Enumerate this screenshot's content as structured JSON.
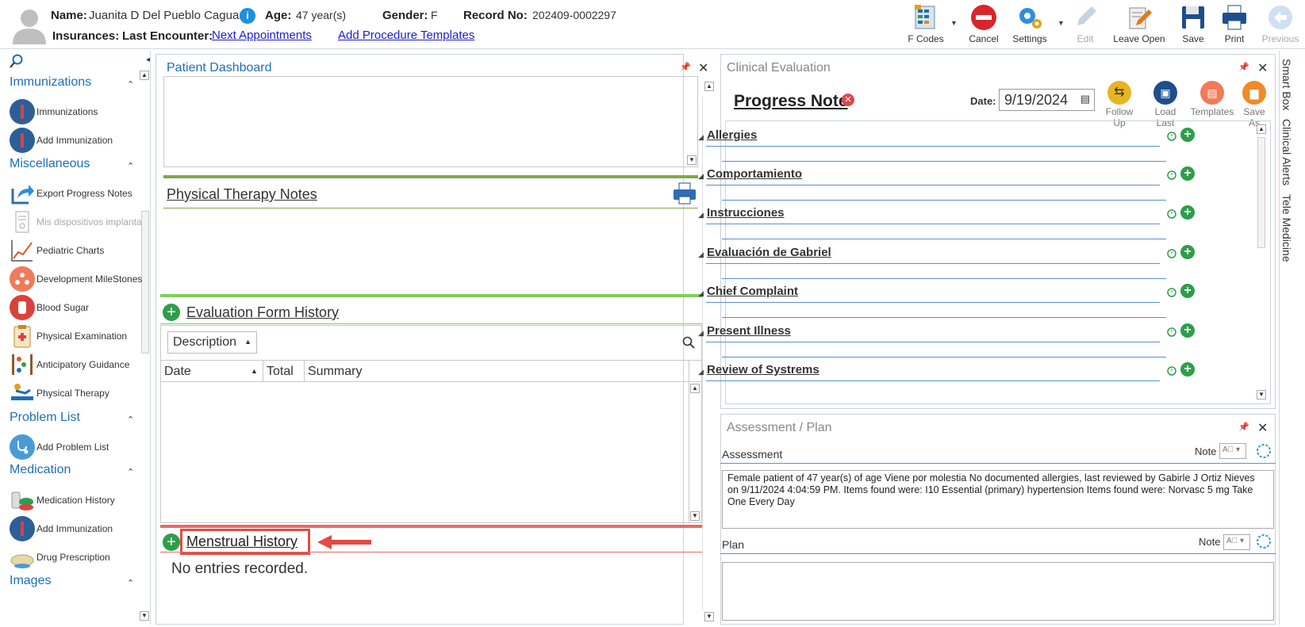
{
  "patient": {
    "name_label": "Name:",
    "name": "Juanita D Del Pueblo Caguas",
    "age_label": "Age:",
    "age": "47 year(s)",
    "gender_label": "Gender:",
    "gender": "F",
    "record_label": "Record No:",
    "record": "202409-0002297",
    "insurances_label": "Insurances:",
    "last_encounter_label": "Last Encounter:",
    "next_appointments": "Next Appointments",
    "add_procedure_templates": "Add Procedure Templates"
  },
  "toolbar": {
    "fcodes": "F Codes",
    "cancel": "Cancel",
    "settings": "Settings",
    "edit": "Edit",
    "leave_open": "Leave Open",
    "save": "Save",
    "print": "Print",
    "previous": "Previous"
  },
  "sidebar": {
    "sections": [
      {
        "title": "Immunizations",
        "items": [
          "Immunizations",
          "Add Immunization"
        ]
      },
      {
        "title": "Miscellaneous",
        "items": [
          "Export Progress Notes",
          "Mis dispositivos implanta",
          "Pediatric Charts",
          "Development MileStones",
          "Blood Sugar",
          "Physical Examination",
          "Anticipatory Guidance",
          "Physical Therapy"
        ]
      },
      {
        "title": "Problem List",
        "items": [
          "Add Problem List"
        ]
      },
      {
        "title": "Medication",
        "items": [
          "Medication History",
          "Add Immunization",
          "Drug Prescription"
        ]
      },
      {
        "title": "Images",
        "items": []
      }
    ]
  },
  "dashboard": {
    "title": "Patient Dashboard",
    "pt_notes": "Physical Therapy Notes",
    "eval_history": "Evaluation Form History",
    "sort_field": "Description",
    "col_date": "Date",
    "col_total": "Total",
    "col_summary": "Summary",
    "menstrual": "Menstrual History",
    "no_entries": "No entries recorded."
  },
  "clinical": {
    "title": "Clinical Evaluation",
    "note_title": "Progress Note",
    "date_label": "Date:",
    "date": "9/19/2024",
    "follow_up": "Follow Up",
    "load_last": "Load Last",
    "templates": "Templates",
    "save_as": "Save As",
    "sections": [
      "Allergies",
      "Comportamiento",
      "Instrucciones",
      "Evaluación de Gabriel",
      "Chief Complaint",
      "Present Illness",
      "Review of Systrems"
    ]
  },
  "assessment": {
    "title": "Assessment / Plan",
    "assessment_label": "Assessment",
    "note": "Note",
    "assessment_text": "Female patient of 47 year(s) of age Viene por molestia     No documented allergies, last reviewed by Gabirle J Ortiz Nieves on 9/11/2024 4:04:59 PM.     Items found were:  I10 Essential (primary) hypertension  Items found were:  Norvasc 5 mg Take One Every Day",
    "plan_label": "Plan",
    "plan_text": ""
  },
  "right_tabs": [
    "Smart Box",
    "Clinical Alerts",
    "Tele Medicine"
  ],
  "colors": {
    "accent": "#1d6fb8",
    "green": "#2e9e4a",
    "highlight": "#e34b45"
  }
}
